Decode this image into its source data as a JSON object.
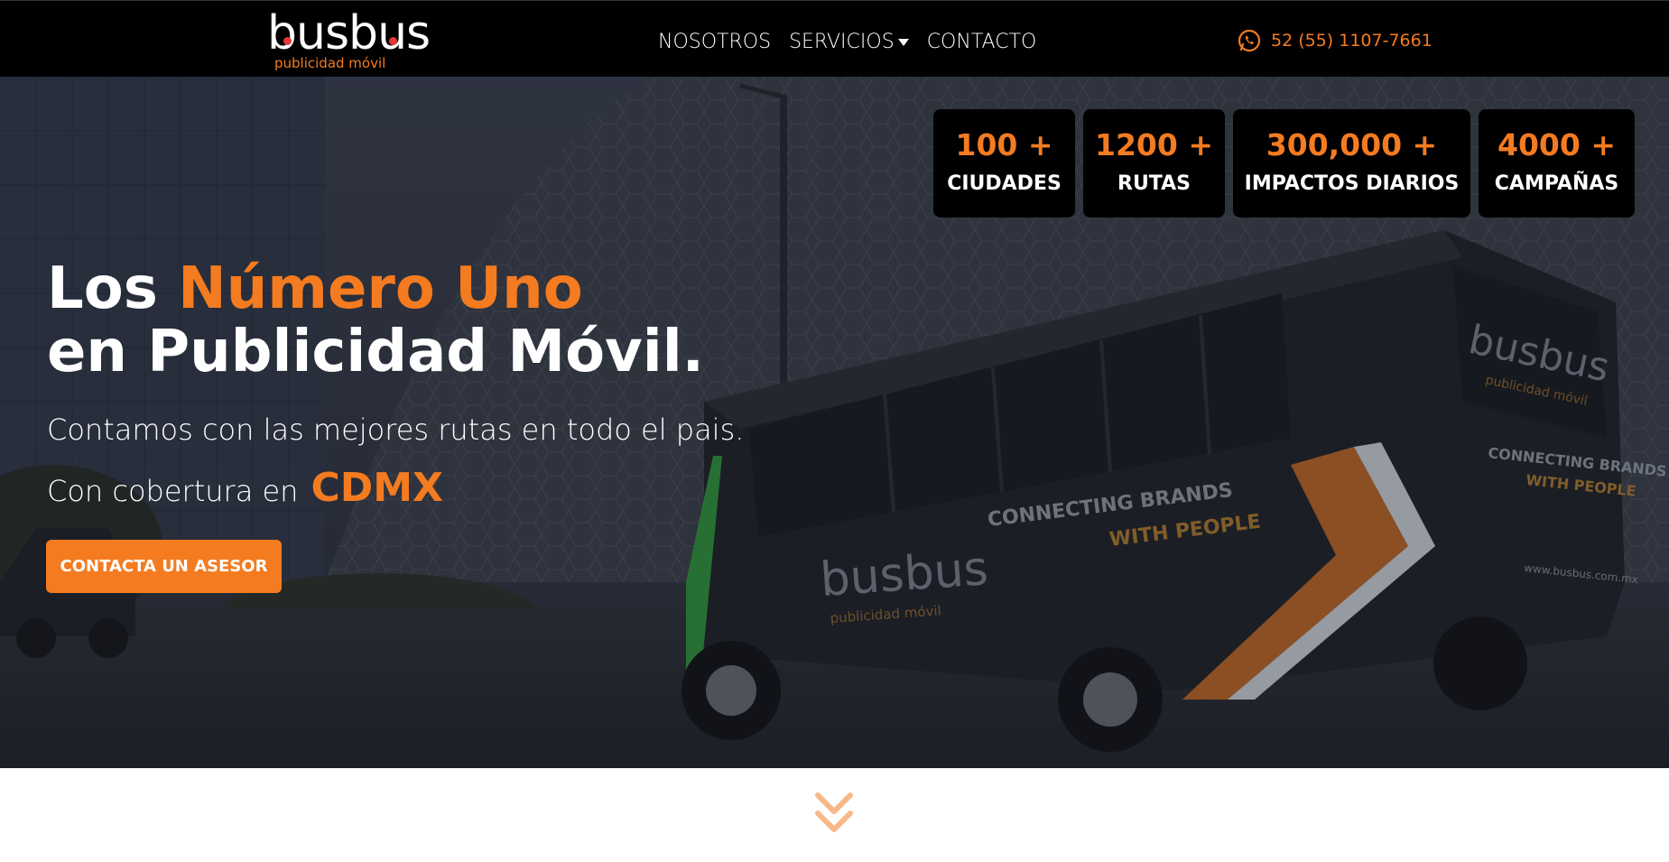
{
  "brand": {
    "name": "busbus",
    "tagline": "publicidad móvil",
    "accent_color": "#f47b20",
    "dark_color": "#000000"
  },
  "nav": {
    "links": [
      {
        "label": "NOSOTROS"
      },
      {
        "label": "SERVICIOS",
        "has_dropdown": true,
        "icon": "caret-down-icon"
      },
      {
        "label": "CONTACTO"
      }
    ]
  },
  "contact": {
    "phone": "52 (55) 1107-7661",
    "icon": "whatsapp-icon"
  },
  "stats": [
    {
      "number": "100 +",
      "label": "CIUDADES"
    },
    {
      "number": "1200 +",
      "label": "RUTAS"
    },
    {
      "number": "300,000 +",
      "label": "IMPACTOS DIARIOS"
    },
    {
      "number": "4000 +",
      "label": "CAMPAÑAS"
    }
  ],
  "hero": {
    "headline_prefix": "Los",
    "headline_accent": "Número Uno",
    "headline_line2": "en Publicidad Móvil.",
    "subtitle": "Contamos con las mejores rutas en todo el pais.",
    "coverage_prefix": "Con cobertura en",
    "coverage_city": "CDMX",
    "cta_label": "CONTACTA UN ASESOR",
    "bus_texts": {
      "side_line1": "CONNECTING BRANDS",
      "side_line2": "WITH PEOPLE",
      "rear_line1": "CONNECTING BRANDS",
      "rear_line2": "WITH PEOPLE",
      "website": "www.busbus.com.mx",
      "logo": "busbus",
      "logo_sub": "publicidad móvil"
    }
  },
  "scroll_icon": "double-chevron-down-icon"
}
